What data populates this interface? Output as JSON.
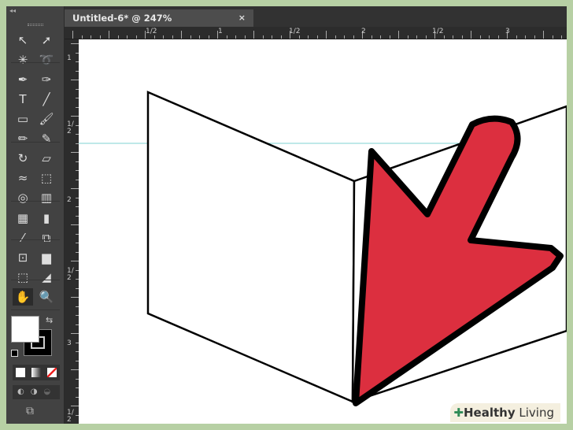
{
  "document": {
    "tab_title": "Untitled-6* @ 247% (CMYK/Preview)",
    "close_label": "×"
  },
  "toolbar": {
    "collapse_label": "◂◂",
    "tools": [
      [
        "selection",
        "↖"
      ],
      [
        "direct-selection",
        "➚"
      ],
      [
        "magic-wand",
        "✳"
      ],
      [
        "lasso",
        "➰"
      ],
      [
        "pen",
        "✒"
      ],
      [
        "curvature",
        "✑"
      ],
      [
        "type",
        "T"
      ],
      [
        "line-segment",
        "╱"
      ],
      [
        "rectangle",
        "▭"
      ],
      [
        "paintbrush",
        "🖌"
      ],
      [
        "pencil",
        "✏"
      ],
      [
        "blob-brush",
        "✎"
      ],
      [
        "rotate",
        "↻"
      ],
      [
        "free-transform",
        "▱"
      ],
      [
        "warp",
        "≈"
      ],
      [
        "perspective-grid-box",
        "⬚"
      ],
      [
        "shape-builder",
        "◎"
      ],
      [
        "perspective-grid",
        "▥"
      ],
      [
        "mesh",
        "▦"
      ],
      [
        "gradient",
        "▮"
      ],
      [
        "eyedropper",
        "⁄"
      ],
      [
        "blend",
        "⧉"
      ],
      [
        "symbol-sprayer",
        "⊡"
      ],
      [
        "column-graph",
        "▆"
      ],
      [
        "artboard",
        "⬚"
      ],
      [
        "slice",
        "◢"
      ],
      [
        "hand",
        "✋"
      ],
      [
        "zoom",
        "🔍"
      ]
    ]
  },
  "rulers": {
    "top": [
      "1/2",
      "1",
      "1/2",
      "2",
      "1/2",
      "3"
    ],
    "left": [
      "1",
      "1/2",
      "2",
      "1/2",
      "3",
      "1/2"
    ]
  },
  "colors": {
    "arrow_fill": "#dc2f3f",
    "guide": "#7fd3d3"
  },
  "watermark": {
    "bold": "Healthy",
    "light": " Living"
  }
}
